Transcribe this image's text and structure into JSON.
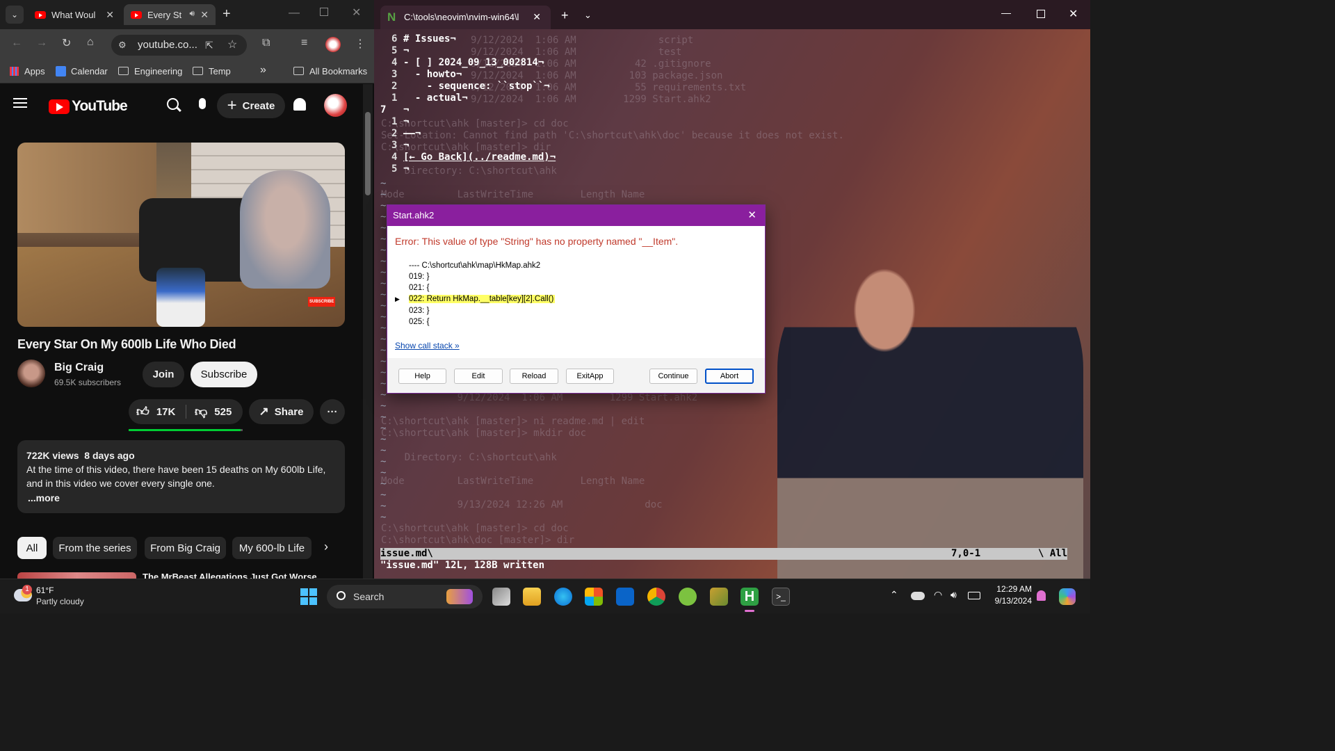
{
  "browser": {
    "tabs": [
      {
        "title": "What Woul",
        "active": false
      },
      {
        "title": "Every St",
        "active": true
      }
    ],
    "new_tab": "+",
    "omnibox_text": "youtube.co...",
    "bookmarks": [
      "Apps",
      "Calendar",
      "Engineering",
      "Temp",
      "All Bookmarks"
    ],
    "bookmarks_overflow": "»"
  },
  "youtube": {
    "logo_text": "YouTube",
    "create_label": "Create",
    "video_title": "Every Star On My 600lb Life Who Died",
    "thumbnail_badge": "SUBSCRIBE",
    "channel_name": "Big Craig",
    "subscribers": "69.5K subscribers",
    "join_label": "Join",
    "subscribe_label": "Subscribe",
    "likes": "17K",
    "dislikes": "525",
    "share_label": "Share",
    "more_label": "···",
    "views_line": "722K views  8 days ago",
    "description_line1": "At the time of this video, there have been 15 deaths on My 600lb Life,",
    "description_line2": "and in this video we cover every single one.",
    "more_link": "...more",
    "chips": [
      "All",
      "From the series",
      "From Big Craig",
      "My 600-lb Life"
    ],
    "next_video_title": "The MrBeast Allegations Just Got Worse"
  },
  "terminal": {
    "tab_title": "C:\\tools\\neovim\\nvim-win64\\l",
    "editor_lines": [
      {
        "num": "6",
        "text": "# Issues¬"
      },
      {
        "num": "5",
        "text": "¬"
      },
      {
        "num": "4",
        "text": "- [ ] 2024_09_13_002814¬"
      },
      {
        "num": "3",
        "text": "  - howto¬"
      },
      {
        "num": "2",
        "text": "    - sequence: ``stop``¬"
      },
      {
        "num": "1",
        "text": "  - actual¬"
      },
      {
        "num": "7",
        "text": "¬"
      },
      {
        "num": "1",
        "text": "¬"
      },
      {
        "num": "2",
        "text": "——¬"
      },
      {
        "num": "3",
        "text": "¬"
      },
      {
        "num": "4",
        "text": "[← Go Back](../readme.md)¬"
      },
      {
        "num": "5",
        "text": "¬"
      }
    ],
    "ghost_lines": [
      "9/12/2024  1:06 AM              script",
      "9/12/2024  1:06 AM              test",
      "9/12/2024  1:06 AM          42 .gitignore",
      "9/12/2024  1:06 AM         103 package.json",
      "9/12/2024  1:06 AM          55 requirements.txt",
      "9/12/2024  1:06 AM        1299 Start.ahk2",
      "C:\\shortcut\\ahk [master]> cd doc",
      "Set-Location: Cannot find path 'C:\\shortcut\\ahk\\doc' because it does not exist.",
      "C:\\shortcut\\ahk [master]> dir",
      "    Directory: C:\\shortcut\\ahk",
      "Mode         LastWriteTime        Length Name",
      "             9/12/2024  1:06 AM        1299 Start.ahk2",
      "C:\\shortcut\\ahk [master]> ni readme.md | edit",
      "C:\\shortcut\\ahk [master]> mkdir doc",
      "    Directory: C:\\shortcut\\ahk",
      "Mode         LastWriteTime        Length Name",
      "             9/13/2024 12:26 AM              doc",
      "C:\\shortcut\\ahk [master]> cd doc",
      "C:\\shortcut\\ahk\\doc [master]> dir"
    ],
    "status_file": "issue.md\\",
    "status_pos": "7,0-1",
    "status_all": "\\ All",
    "message": "\"issue.md\" 12L, 128B written"
  },
  "dialog": {
    "title": "Start.ahk2",
    "error": "Error: This value of type \"String\" has no property named \"__Item\".",
    "code_lines": [
      "---- C:\\shortcut\\ahk\\map\\HkMap.ahk2",
      "019: }",
      "021: {",
      "022: Return HkMap.__table[key][2].Call()",
      "023: }",
      "025: {"
    ],
    "highlight_index": 3,
    "call_stack_link": "Show call stack »",
    "buttons": [
      "Help",
      "Edit",
      "Reload",
      "ExitApp",
      "Continue",
      "Abort"
    ]
  },
  "taskbar": {
    "weather_temp": "61°F",
    "weather_desc": "Partly cloudy",
    "weather_badge": "1",
    "search_label": "Search",
    "time": "12:29 AM",
    "date": "9/13/2024"
  },
  "colors": {
    "youtube_red": "#ff0000",
    "dialog_title": "#8a1f9e",
    "error_text": "#c0392b",
    "highlight": "#ffff66"
  }
}
